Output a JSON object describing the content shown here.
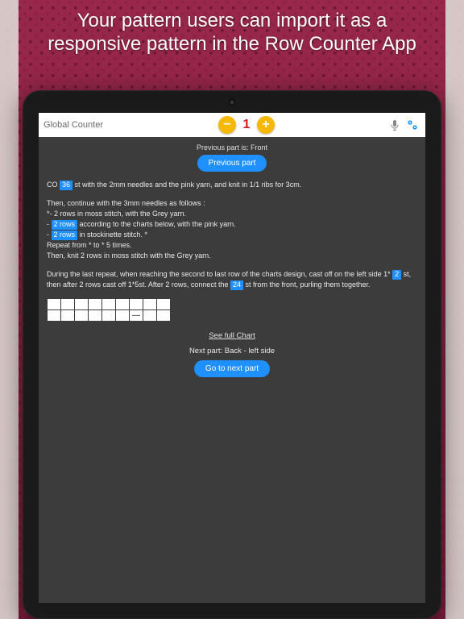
{
  "marketing": {
    "headline": "Your pattern users can import it as a responsive pattern in the Row Counter App"
  },
  "toolbar": {
    "title": "Global Counter",
    "counter_value": "1"
  },
  "body": {
    "previous_part_label": "Previous part is: Front",
    "previous_part_button": "Previous part",
    "co_prefix": "CO ",
    "co_hl": "36",
    "co_suffix": " st with the 2mm needles and the pink yarn, and knit in 1/1 ribs for 3cm.",
    "block2_line1": "Then, continue with the 3mm needles as follows :",
    "block2_line2": "*- 2 rows in moss stitch, with the Grey yarn.",
    "block2_line3_prefix": "- ",
    "block2_line3_hl": "2 rows",
    "block2_line3_suffix": " according to the charts below, with the pink yarn.",
    "block2_line4_prefix": "- ",
    "block2_line4_hl": "2 rows",
    "block2_line4_suffix": " in stockinette stitch. *",
    "block2_line5": "Repeat from * to * 5 times.",
    "block2_line6": "Then, knit 2 rows in moss stitch with the Grey yarn.",
    "block3_prefix": "During the last repeat, when reaching the second to last row of the charts design, cast off on the left side 1* ",
    "block3_hl1": "2",
    "block3_mid": " st, then after 2 rows cast off 1*5st. After 2 rows, connect the ",
    "block3_hl2": "24",
    "block3_suffix": " st from the front, purling them together.",
    "see_full_chart": "See full Chart",
    "next_part_label": "Next part: Back - left side",
    "go_next_button": "Go to next part"
  }
}
